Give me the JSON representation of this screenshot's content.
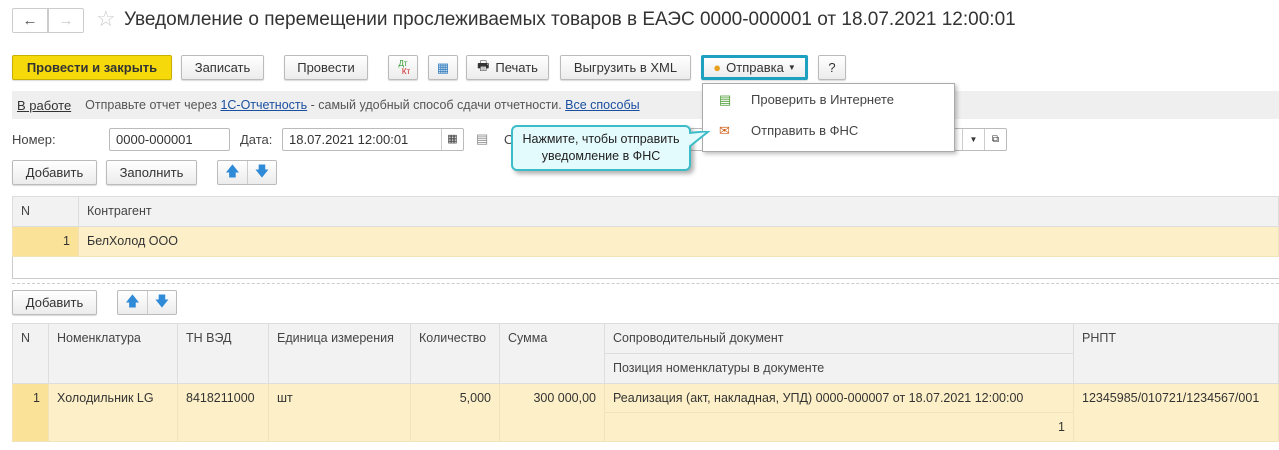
{
  "title": "Уведомление о перемещении прослеживаемых товаров в ЕАЭС 0000-000001 от 18.07.2021 12:00:01",
  "toolbar": {
    "post_close": "Провести и закрыть",
    "save": "Записать",
    "post": "Провести",
    "dtkt_dt": "Дт",
    "dtkt_kt": "Кт",
    "print": "Печать",
    "export_xml": "Выгрузить в XML",
    "send": "Отправка",
    "help": "?"
  },
  "infobar": {
    "status": "В работе",
    "text1": "Отправьте отчет через ",
    "link": "1С-Отчетность",
    "text2": " - самый удобный способ сдачи отчетности. ",
    "all": "Все способы"
  },
  "form": {
    "number_label": "Номер:",
    "number": "0000-000001",
    "date_label": "Дата:",
    "date": "18.07.2021 12:00:01",
    "org_label_partial": "О"
  },
  "send_menu": {
    "items": [
      {
        "label": "Проверить в Интернете"
      },
      {
        "label": "Отправить в ФНС"
      }
    ]
  },
  "tooltip": {
    "line1": "Нажмите, чтобы отправить",
    "line2": "уведомление в ФНС"
  },
  "contractors": {
    "add": "Добавить",
    "fill": "Заполнить",
    "headers": [
      "N",
      "Контрагент"
    ],
    "rows": [
      {
        "n": "1",
        "name": "БелХолод ООО"
      }
    ]
  },
  "goods": {
    "add": "Добавить",
    "headers": {
      "n": "N",
      "item": "Номенклатура",
      "tnved": "ТН ВЭД",
      "unit": "Единица измерения",
      "qty": "Количество",
      "sum": "Сумма",
      "doc": "Сопроводительный документ",
      "pos": "Позиция номенклатуры в документе",
      "rnpt": "РНПТ"
    },
    "rows": [
      {
        "n": "1",
        "item": "Холодильник  LG",
        "tnved": "8418211000",
        "unit": "шт",
        "qty": "5,000",
        "sum": "300 000,00",
        "doc": "Реализация (акт, накладная, УПД) 0000-000007 от 18.07.2021 12:00:00",
        "pos": "1",
        "rnpt": "12345985/010721/1234567/001"
      }
    ]
  }
}
